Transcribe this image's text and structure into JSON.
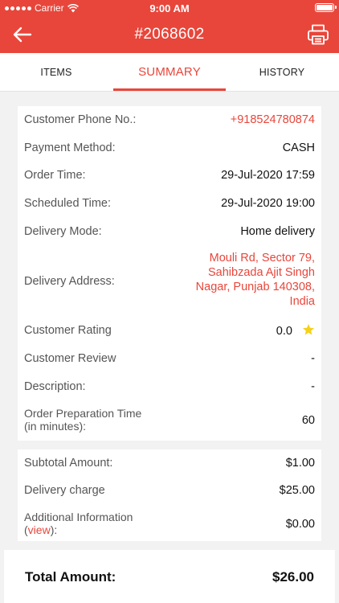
{
  "status_bar": {
    "carrier": "Carrier",
    "time": "9:00 AM"
  },
  "header": {
    "title": "#2068602",
    "back_icon": "arrow-left-icon",
    "print_icon": "printer-icon"
  },
  "tabs": [
    {
      "label": "ITEMS",
      "active": false
    },
    {
      "label": "SUMMARY",
      "active": true
    },
    {
      "label": "HISTORY",
      "active": false
    }
  ],
  "details": {
    "phone": {
      "label": "Customer Phone No.:",
      "value": "+918524780874"
    },
    "payment": {
      "label": "Payment Method:",
      "value": "CASH"
    },
    "order_time": {
      "label": "Order Time:",
      "value": "29-Jul-2020 17:59"
    },
    "scheduled_time": {
      "label": "Scheduled Time:",
      "value": "29-Jul-2020 19:00"
    },
    "delivery_mode": {
      "label": "Delivery Mode:",
      "value": "Home delivery"
    },
    "delivery_address": {
      "label": "Delivery Address:",
      "value": "Mouli Rd, Sector 79, Sahibzada Ajit Singh Nagar, Punjab 140308, India"
    },
    "rating": {
      "label": "Customer Rating",
      "value": "0.0",
      "icon": "star-icon"
    },
    "review": {
      "label": "Customer Review",
      "value": "-"
    },
    "description": {
      "label": "Description:",
      "value": "-"
    },
    "prep_time": {
      "label_line1": "Order Preparation Time",
      "label_line2": "(in minutes):",
      "value": "60"
    }
  },
  "charges": {
    "subtotal": {
      "label": "Subtotal Amount:",
      "value": "$1.00"
    },
    "delivery": {
      "label": "Delivery charge",
      "value": "$25.00"
    },
    "additional": {
      "label_line1": "Additional Information",
      "label_prefix": "(",
      "link": "view",
      "label_suffix": "):",
      "value": "$0.00"
    }
  },
  "total": {
    "label": "Total Amount:",
    "value": "$26.00"
  },
  "colors": {
    "accent": "#e8463b",
    "star": "#f5d11a",
    "background": "#f2f2f2"
  }
}
